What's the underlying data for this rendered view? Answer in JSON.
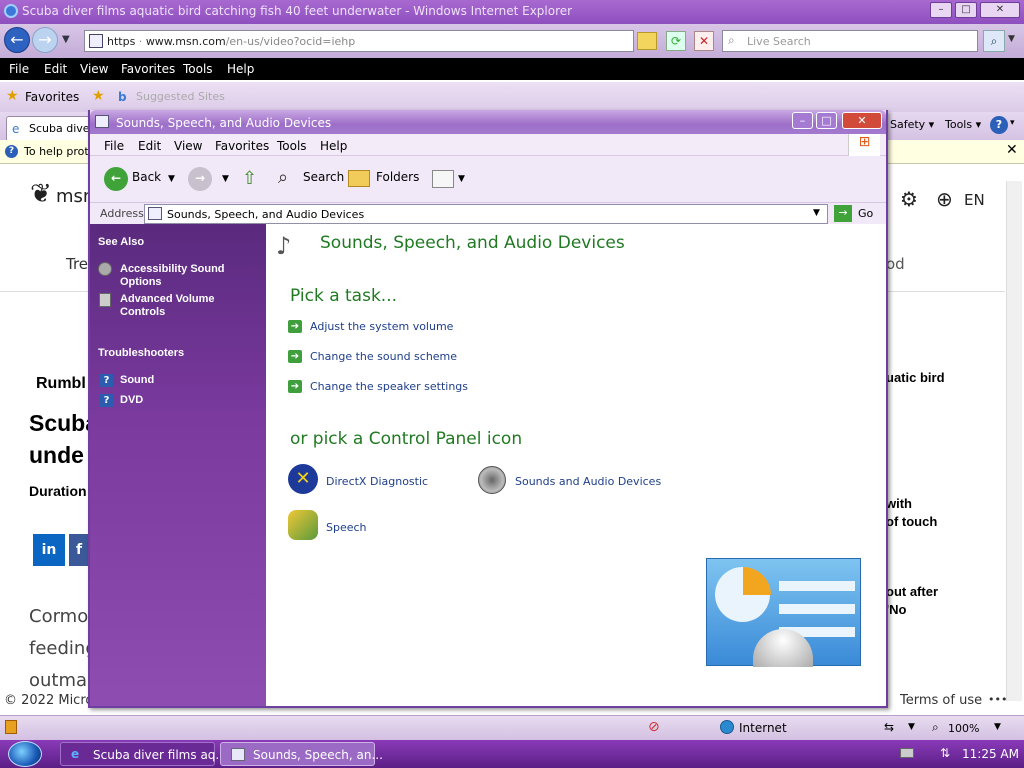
{
  "ie": {
    "title": "Scuba diver films aquatic bird catching fish 40 feet underwater - Windows Internet Explorer",
    "address_prefix": "https",
    "address_domain": "www.msn.com",
    "address_path": "/en-us/video?ocid=iehp",
    "search_placeholder": "Live Search",
    "menu": [
      "File",
      "Edit",
      "View",
      "Favorites",
      "Tools",
      "Help"
    ],
    "favorites_label": "Favorites",
    "suggested_sites": "Suggested Sites",
    "tab_label": "Scuba diver",
    "right_tools": [
      "Safety",
      "Tools"
    ],
    "info_bar_text": "To help prot",
    "status_zone": "Internet",
    "zoom": "100%"
  },
  "web": {
    "brand": "msn",
    "lang": "EN",
    "trending": "Tre",
    "right_od": "od",
    "rumble": "Rumbl",
    "headline1": "Scuba",
    "headline2": "unde",
    "duration": "Duration",
    "side_text1": "uatic bird",
    "side_text2": "with",
    "side_text3": "of touch",
    "side_text4": "out after",
    "side_text5": "'No",
    "para1": "Cormor",
    "para2": "feeding",
    "para3": "outmar",
    "copyright": "© 2022 Micros",
    "terms": "Terms of use",
    "more": "•••"
  },
  "cp": {
    "title": "Sounds, Speech, and Audio Devices",
    "menu": [
      "File",
      "Edit",
      "View",
      "Favorites",
      "Tools",
      "Help"
    ],
    "toolbar": {
      "back": "Back",
      "search": "Search",
      "folders": "Folders"
    },
    "address_label": "Address",
    "address_value": "Sounds, Speech, and Audio Devices",
    "go": "Go",
    "see_also": "See Also",
    "see_also_items": [
      "Accessibility Sound Options",
      "Advanced Volume Controls"
    ],
    "troubleshooters": "Troubleshooters",
    "troubleshooter_items": [
      "Sound",
      "DVD"
    ],
    "heading": "Sounds, Speech, and Audio Devices",
    "pick_task": "Pick a task...",
    "tasks": [
      "Adjust the system volume",
      "Change the sound scheme",
      "Change the speaker settings"
    ],
    "pick_icon": "or pick a Control Panel icon",
    "icons": [
      "DirectX Diagnostic",
      "Sounds and Audio Devices",
      "Speech"
    ]
  },
  "taskbar": {
    "items": [
      "Scuba diver films aq...",
      "Sounds, Speech, an..."
    ],
    "time": "11:25 AM"
  }
}
